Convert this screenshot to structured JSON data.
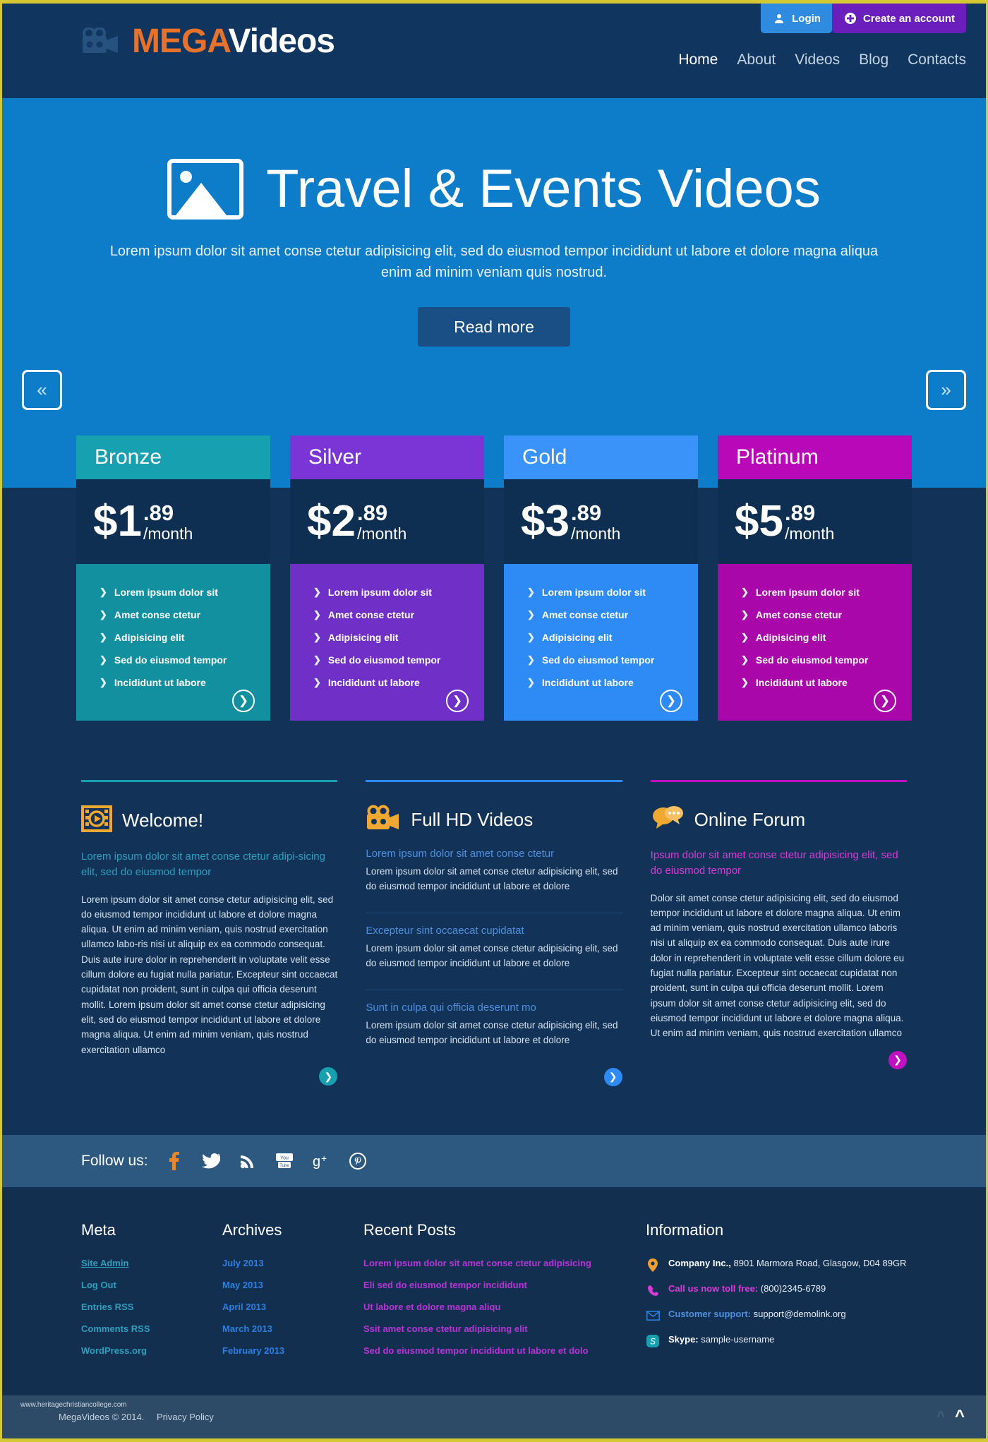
{
  "header": {
    "auth": [
      {
        "label": "Login",
        "icon": "user-icon",
        "color": "#2e8be0"
      },
      {
        "label": "Create an account",
        "icon": "plus-circle-icon",
        "color": "#6a1fbd"
      }
    ],
    "logo": {
      "icon": "video-camera-icon",
      "part1": "MEGA",
      "part2": "Videos"
    },
    "nav": [
      {
        "label": "Home",
        "active": true
      },
      {
        "label": "About",
        "active": false
      },
      {
        "label": "Videos",
        "active": false
      },
      {
        "label": "Blog",
        "active": false
      },
      {
        "label": "Contacts",
        "active": false
      }
    ]
  },
  "hero": {
    "icon": "image-placeholder-icon",
    "title": "Travel & Events Videos",
    "subtitle": "Lorem ipsum dolor sit amet conse ctetur adipisicing elit, sed do eiusmod tempor incididunt ut labore et dolore magna aliqua enim ad minim veniam quis nostrud.",
    "cta": "Read more",
    "prev": "«",
    "next": "»",
    "bg": "#0d7cc9"
  },
  "pricing": {
    "plans": [
      {
        "name": "Bronze",
        "accent": "#12909f",
        "head_accent": "#16a0b0",
        "dollar": "$1",
        "cents": ".89",
        "period": "/month",
        "features": [
          "Lorem ipsum dolor sit",
          "Amet conse ctetur",
          "Adipisicing elit",
          "Sed do eiusmod tempor",
          "Incididunt ut labore"
        ]
      },
      {
        "name": "Silver",
        "accent": "#7030c8",
        "head_accent": "#7b35d6",
        "dollar": "$2",
        "cents": ".89",
        "period": "/month",
        "features": [
          "Lorem ipsum dolor sit",
          "Amet conse ctetur",
          "Adipisicing elit",
          "Sed do eiusmod tempor",
          "Incididunt ut labore"
        ]
      },
      {
        "name": "Gold",
        "accent": "#2e8bf5",
        "head_accent": "#3a93f8",
        "dollar": "$3",
        "cents": ".89",
        "period": "/month",
        "features": [
          "Lorem ipsum dolor sit",
          "Amet conse ctetur",
          "Adipisicing elit",
          "Sed do eiusmod tempor",
          "Incididunt ut labore"
        ]
      },
      {
        "name": "Platinum",
        "accent": "#aa07aa",
        "head_accent": "#b808b8",
        "dollar": "$5",
        "cents": ".89",
        "period": "/month",
        "features": [
          "Lorem ipsum dolor sit",
          "Amet conse ctetur",
          "Adipisicing elit",
          "Sed do eiusmod tempor",
          "Incididunt ut labore"
        ]
      }
    ]
  },
  "features": {
    "welcome": {
      "rule_color": "#16a0b0",
      "icon": "film-strip-icon",
      "title": "Welcome!",
      "lead": "Lorem ipsum dolor sit amet conse ctetur adipi-sicing elit, sed do eiusmod tempor",
      "lead_color": "#2f9fbe",
      "body": "Lorem ipsum dolor sit amet conse ctetur adipisicing elit, sed do eiusmod tempor incididunt ut labore et dolore magna aliqua. Ut enim ad minim veniam, quis nostrud exercitation ullamco labo-ris nisi ut aliquip ex ea commodo consequat. Duis aute irure dolor in reprehenderit in voluptate velit esse cillum dolore eu fugiat nulla pariatur. Excepteur sint occaecat cupidatat non proident, sunt in culpa qui officia deserunt mollit. Lorem ipsum dolor sit amet conse ctetur adipisicing elit, sed do eiusmod tempor incididunt ut labore et dolore magna aliqua. Ut enim ad minim veniam, quis nostrud exercitation ullamco",
      "go_color": "#16a0b0"
    },
    "hdvideos": {
      "rule_color": "#2e8bf5",
      "icon": "video-camera-icon",
      "title": "Full HD Videos",
      "go_color": "#2e8bf5",
      "blocks": [
        {
          "sub": "Lorem ipsum dolor sit amet conse ctetur",
          "sub_color": "#4f8fe0",
          "text": "Lorem ipsum dolor sit amet conse ctetur adipisicing elit, sed do eiusmod tempor incididunt ut labore et dolore"
        },
        {
          "sub": "Excepteur sint occaecat cupidatat",
          "sub_color": "#4f8fe0",
          "text": "Lorem ipsum dolor sit amet conse ctetur adipisicing elit, sed do eiusmod tempor incididunt ut labore et dolore"
        },
        {
          "sub": "Sunt in culpa qui officia deserunt mo",
          "sub_color": "#4f8fe0",
          "text": "Lorem ipsum dolor sit amet conse ctetur adipisicing elit, sed do eiusmod tempor incididunt ut labore et dolore"
        }
      ]
    },
    "forum": {
      "rule_color": "#c010c0",
      "icon": "chat-bubbles-icon",
      "title": "Online Forum",
      "lead": "Ipsum dolor sit amet conse ctetur adipisicing elit, sed do eiusmod tempor",
      "lead_color": "#d83bd8",
      "body": "Dolor sit amet conse ctetur adipisicing elit, sed do eiusmod tempor incididunt ut labore et dolore magna aliqua. Ut enim ad minim veniam, quis nostrud exercitation ullamco laboris nisi ut aliquip ex ea commodo consequat. Duis aute irure dolor in reprehenderit in voluptate velit esse cillum dolore eu fugiat nulla pariatur. Excepteur sint occaecat cupidatat non proident, sunt in culpa qui officia deserunt mollit. Lorem ipsum dolor sit amet conse ctetur adipisicing elit, sed do eiusmod tempor incididunt ut labore et dolore magna aliqua. Ut enim ad minim veniam, quis nostrud exercitation ullamco",
      "go_color": "#c010c0"
    }
  },
  "follow": {
    "label": "Follow us:",
    "icons": [
      {
        "name": "facebook-icon",
        "glyph": "f",
        "color": "#e8872c"
      },
      {
        "name": "twitter-icon",
        "glyph": "🐦",
        "color": "#ffffff"
      },
      {
        "name": "rss-icon",
        "glyph": "◔",
        "color": "#ffffff"
      },
      {
        "name": "youtube-icon",
        "glyph": "▶",
        "color": "#ffffff"
      },
      {
        "name": "google-plus-icon",
        "glyph": "g+",
        "color": "#ffffff"
      },
      {
        "name": "pinterest-icon",
        "glyph": "ⓟ",
        "color": "#ffffff"
      }
    ]
  },
  "footer": {
    "meta": {
      "title": "Meta",
      "color": "#2f9fbe",
      "links": [
        "Site Admin",
        "Log Out",
        "Entries RSS",
        "Comments RSS",
        "WordPress.org"
      ]
    },
    "archives": {
      "title": "Archives",
      "color": "#2d7fe0",
      "links": [
        "July 2013",
        "May 2013",
        "April 2013",
        "March 2013",
        "February 2013"
      ]
    },
    "posts": {
      "title": "Recent Posts",
      "color": "#b436d6",
      "links": [
        "Lorem ipsum dolor sit amet conse ctetur adipisicing",
        "Eli sed do eiusmod tempor incididunt",
        "Ut labore et dolore magna aliqu",
        "Ssit amet conse ctetur adipisicing elit",
        "Sed do eiusmod tempor incididunt ut labore et dolo"
      ]
    },
    "info": {
      "title": "Information",
      "rows": [
        {
          "icon": "map-pin-icon",
          "icon_color": "#f0a030",
          "label": "Company Inc.,",
          "label_color": "#ffffff",
          "value": "8901 Marmora Road, Glasgow, D04 89GR"
        },
        {
          "icon": "phone-icon",
          "icon_color": "#d83bd8",
          "label": "Call us now toll free:",
          "label_color": "#d83bd8",
          "value": "(800)2345-6789"
        },
        {
          "icon": "envelope-icon",
          "icon_color": "#2d7fe0",
          "label": "Customer support:",
          "label_color": "#4f8fe0",
          "value": "support@demolink.org"
        },
        {
          "icon": "skype-icon",
          "icon_color": "#16a0b0",
          "label": "Skype:",
          "label_color": "#ffffff",
          "value": "sample-username"
        }
      ]
    }
  },
  "bottom": {
    "watermark": "www.heritagechristiancollege.com",
    "copyright": "MegaVideos © 2014.",
    "privacy": "Privacy Policy",
    "scroll_top_icon": "chevron-up-icon"
  }
}
